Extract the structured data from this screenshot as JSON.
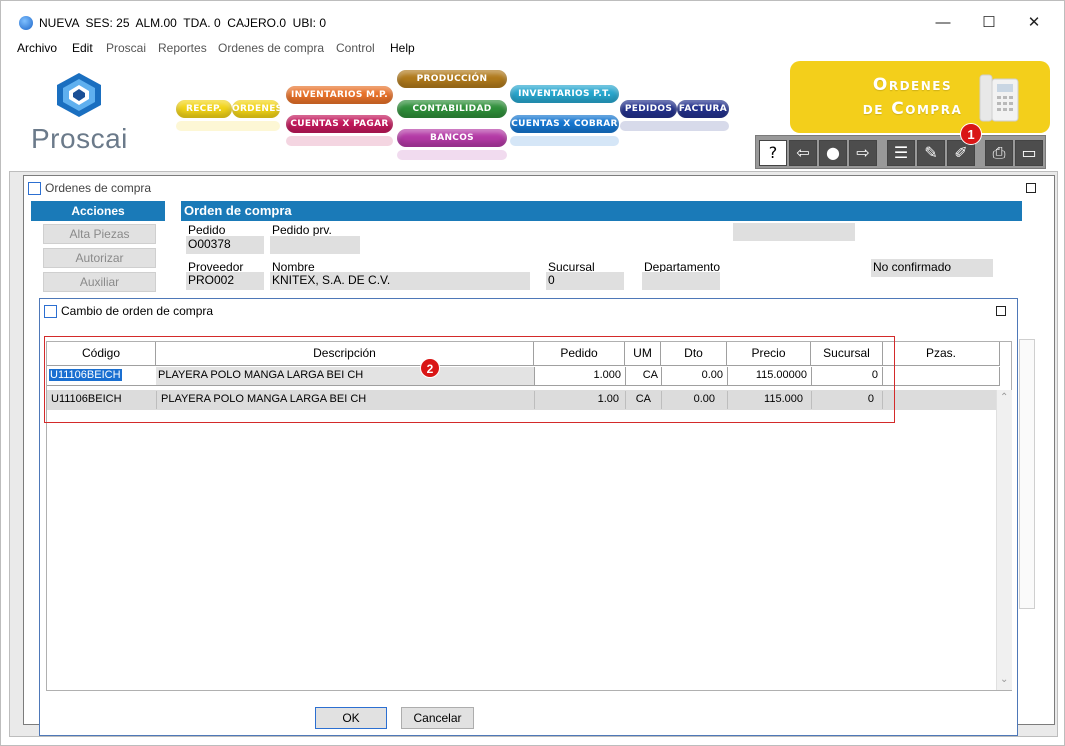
{
  "titlebar": {
    "title": "NUEVA  SES: 25  ALM.00  TDA. 0  CAJERO.0  UBI: 0",
    "minimize": "—",
    "maximize": "☐",
    "close": "✕"
  },
  "menu": [
    "Archivo",
    "Edit",
    "Proscai",
    "Reportes",
    "Ordenes de compra",
    "Control",
    "Help"
  ],
  "banner": {
    "logo_text": "Proscai",
    "pills": {
      "recep": "RECEP.",
      "ordenes": "ORDENES",
      "inventarios_mp": "INVENTARIOS M.P.",
      "cuentas_pagar": "CUENTAS X PAGAR",
      "produccion": "PRODUCCIÓN",
      "contabilidad": "CONTABILIDAD",
      "bancos": "BANCOS",
      "inventarios_pt": "INVENTARIOS P.T.",
      "cuentas_cobrar": "CUENTAS X COBRAR",
      "pedidos": "PEDIDOS",
      "factura": "FACTURA"
    },
    "colors": {
      "yellow": "#f2d418",
      "orange": "#e8722a",
      "brown": "#b07a1c",
      "green": "#2f8f3a",
      "magenta": "#b43aa6",
      "cyan": "#28a7cf",
      "navy": "#23318c",
      "blue": "#1576d0",
      "oc_panel": "#f3cf1b",
      "badge": "#d91616"
    },
    "section_title_line1": "Ordenes",
    "section_title_line2": "de Compra",
    "toolbar_icons": [
      "help-icon",
      "arrow-left-icon",
      "search-person-icon",
      "arrow-right-icon",
      "list-icon",
      "edit-document-icon",
      "modify-icon",
      "print-icon",
      "window-icon"
    ],
    "badge1": "1"
  },
  "oc_window": {
    "title": "Ordenes de compra",
    "sidebar": {
      "header": "Acciones",
      "items": [
        "Alta Piezas",
        "Autorizar",
        "Auxiliar"
      ]
    },
    "section_header": "Orden de compra",
    "fields": {
      "pedido_label": "Pedido",
      "pedido_value": "O00378",
      "pedido_prv_label": "Pedido prv.",
      "pedido_prv_value": "",
      "proveedor_label": "Proveedor",
      "proveedor_value": "PRO002",
      "nombre_label": "Nombre",
      "nombre_value": "KNITEX, S.A. DE C.V.",
      "sucursal_label": "Sucursal",
      "sucursal_value": "0",
      "departamento_label": "Departamento",
      "departamento_value": "",
      "status_value": "No confirmado"
    }
  },
  "modal": {
    "title": "Cambio de orden de compra",
    "headers": [
      "Código",
      "Descripción",
      "Pedido",
      "UM",
      "Dto",
      "Precio",
      "Sucursal",
      "Pzas."
    ],
    "edit_row": {
      "codigo": "U11106BEICH",
      "descripcion": "PLAYERA POLO MANGA LARGA BEI CH",
      "pedido": "1.000",
      "um": "CA",
      "dto": "0.00",
      "precio": "115.00000",
      "sucursal": "0",
      "pzas": ""
    },
    "rows": [
      {
        "codigo": "U11106BEICH",
        "descripcion": "PLAYERA POLO MANGA LARGA BEI CH",
        "pedido": "1.00",
        "um": "CA",
        "dto": "0.00",
        "precio": "115.000",
        "sucursal": "0"
      }
    ],
    "badge2": "2",
    "ok": "OK",
    "cancel": "Cancelar",
    "maximize": "☐"
  }
}
